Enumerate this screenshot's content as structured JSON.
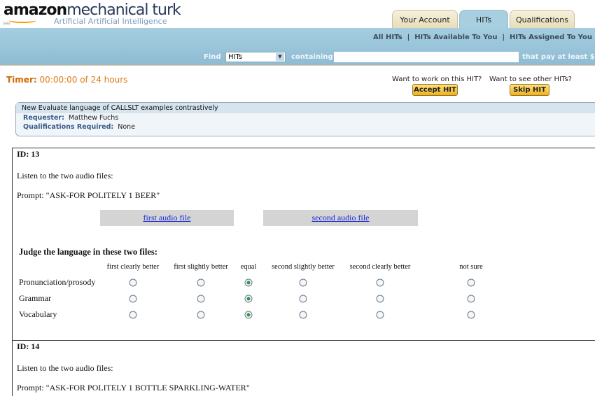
{
  "logo": {
    "brand": "amazon",
    "product": "mechanical turk",
    "tagline": "Artificial Artificial Intelligence",
    "beta": "beta"
  },
  "tabs": [
    {
      "label": "Your Account"
    },
    {
      "label": "HITs",
      "active": true
    },
    {
      "label": "Qualifications"
    }
  ],
  "nav_links": [
    "All HITs",
    "HITs Available To You",
    "HITs Assigned To You"
  ],
  "search": {
    "find_label": "Find",
    "select_value": "HITs",
    "containing_label": "containing",
    "input_value": "",
    "pay_label": "that pay at least $"
  },
  "timer": {
    "label": "Timer:",
    "value": "00:00:00 of 24 hours"
  },
  "accept": {
    "question": "Want to work on this HIT?",
    "button": "Accept HIT"
  },
  "skip": {
    "question": "Want to see other HITs?",
    "button": "Skip HIT"
  },
  "hit": {
    "title": "New Evaluate language of CALLSLT examples contrastively",
    "requester_label": "Requester:",
    "requester": "Matthew Fuchs",
    "qual_label": "Qualifications Required:",
    "qual": "None"
  },
  "items": [
    {
      "id": "ID: 13",
      "instruction": "Listen to the two audio files:",
      "prompt": "Prompt: \"ASK-FOR POLITELY 1 BEER\"",
      "audio1": "first audio file",
      "audio2": "second audio file",
      "judge": "Judge the language in these two files:",
      "columns": [
        "first clearly better",
        "first slightly better",
        "equal",
        "second slightly better",
        "second clearly better",
        "not sure"
      ],
      "rows": [
        {
          "label": "Pronunciation/prosody",
          "selected": 2
        },
        {
          "label": "Grammar",
          "selected": 2
        },
        {
          "label": "Vocabulary",
          "selected": 2
        }
      ]
    },
    {
      "id": "ID: 14",
      "instruction": "Listen to the two audio files:",
      "prompt": "Prompt: \"ASK-FOR POLITELY 1 BOTTLE SPARKLING-WATER\""
    }
  ]
}
